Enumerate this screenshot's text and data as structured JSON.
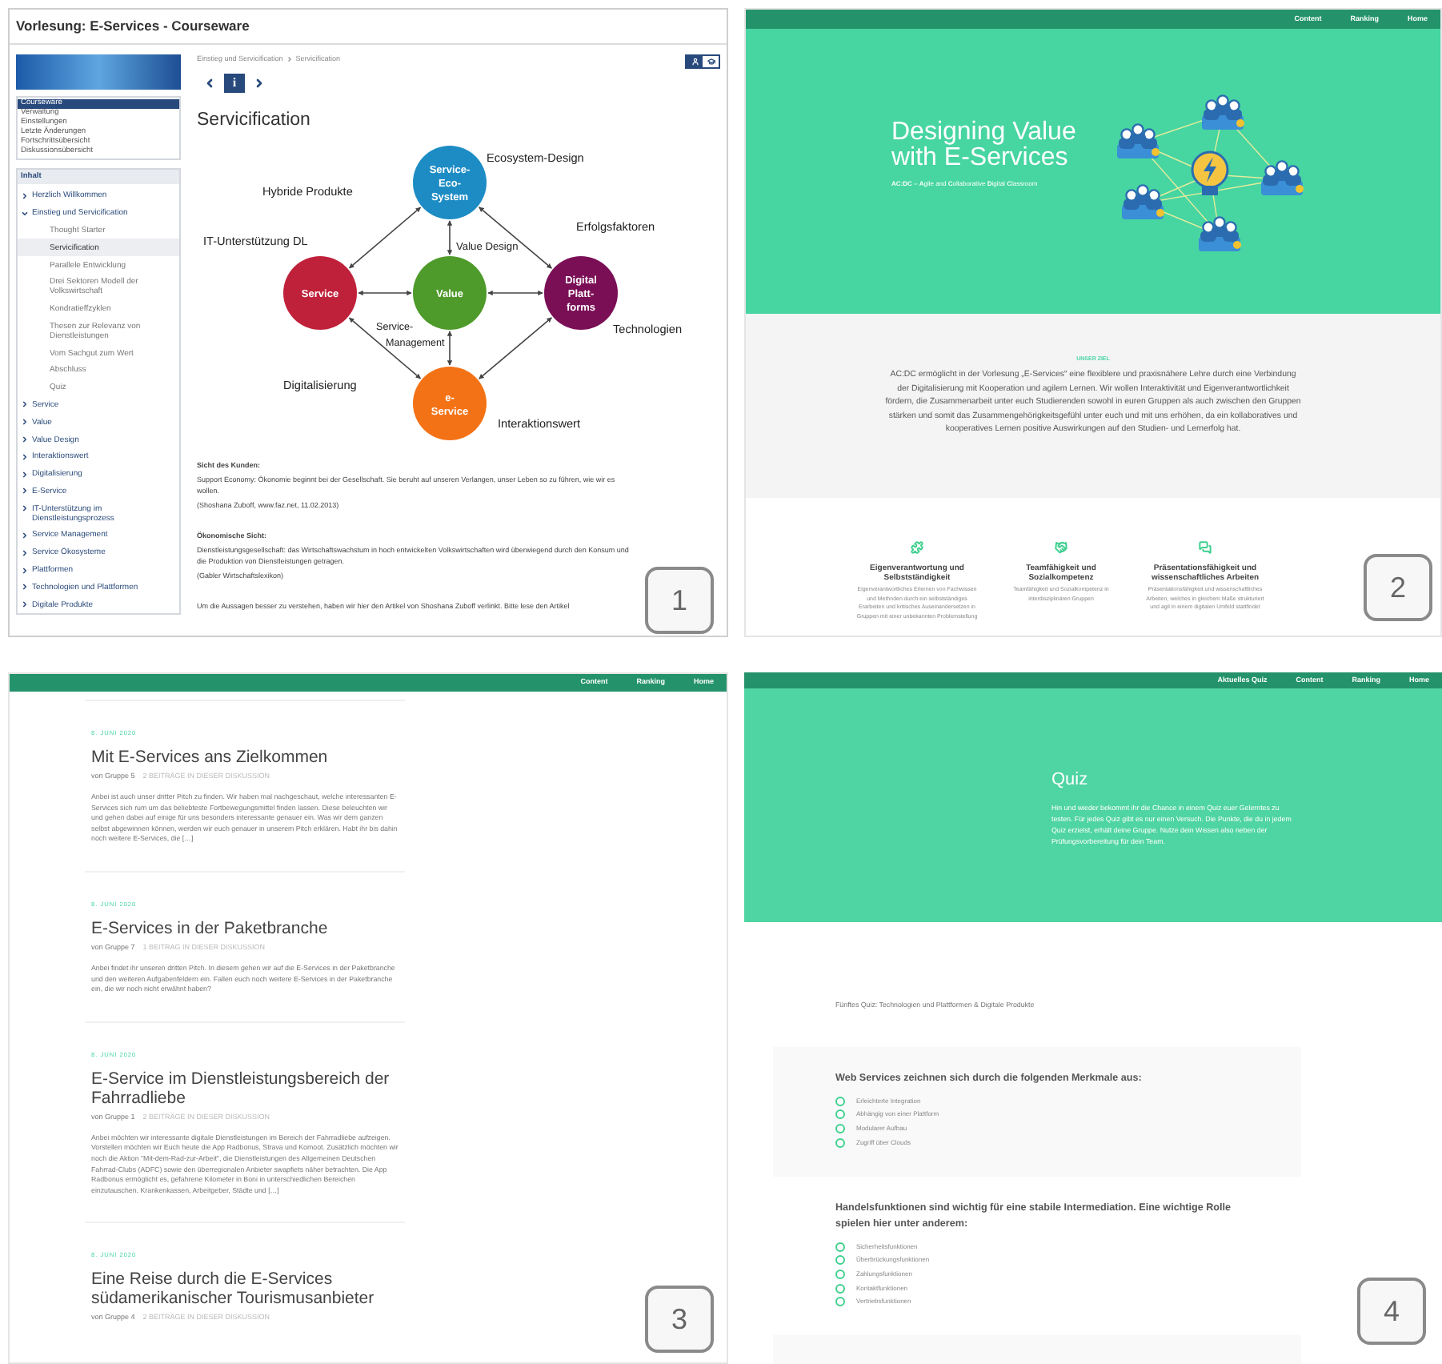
{
  "courseware": {
    "title": "Vorlesung: E-Services - Courseware",
    "menu": [
      {
        "label": "Courseware",
        "selected": true
      },
      {
        "label": "Verwaltung",
        "selected": false
      },
      {
        "label": "Einstellungen",
        "selected": false
      },
      {
        "label": "Letzte Änderungen",
        "selected": false
      },
      {
        "label": "Fortschrittsübersicht",
        "selected": false
      },
      {
        "label": "Diskussionsübersicht",
        "selected": false
      }
    ],
    "contents_header": "Inhalt",
    "tree": [
      {
        "label": "Herzlich Willkommen",
        "expanded": false
      },
      {
        "label": "Einstieg und Servicification",
        "expanded": true,
        "children": [
          {
            "label": "Thought Starter",
            "selected": false
          },
          {
            "label": "Servicification",
            "selected": true
          },
          {
            "label": "Parallele Entwicklung",
            "selected": false
          },
          {
            "label": "Drei Sektoren Modell der Volkswirtschaft",
            "selected": false
          },
          {
            "label": "Kondratieffzyklen",
            "selected": false
          },
          {
            "label": "Thesen zur Relevanz von Dienstleistungen",
            "selected": false
          },
          {
            "label": "Vom Sachgut zum Wert",
            "selected": false
          },
          {
            "label": "Abschluss",
            "selected": false
          },
          {
            "label": "Quiz",
            "selected": false
          }
        ]
      },
      {
        "label": "Service",
        "expanded": false
      },
      {
        "label": "Value",
        "expanded": false
      },
      {
        "label": "Value Design",
        "expanded": false
      },
      {
        "label": "Interaktionswert",
        "expanded": false
      },
      {
        "label": "Digitalisierung",
        "expanded": false
      },
      {
        "label": "E-Service",
        "expanded": false
      },
      {
        "label": "IT-Unterstützung im Dienstleistungsprozess",
        "expanded": false
      },
      {
        "label": "Service Management",
        "expanded": false
      },
      {
        "label": "Service Ökosysteme",
        "expanded": false
      },
      {
        "label": "Plattformen",
        "expanded": false
      },
      {
        "label": "Technologien und Plattformen",
        "expanded": false
      },
      {
        "label": "Digitale Produkte",
        "expanded": false
      }
    ],
    "breadcrumb": [
      "Einstieg und Servicification",
      "Servicification"
    ],
    "view_toggle": [
      {
        "selected": true
      },
      {
        "selected": false
      }
    ],
    "info_button": "i",
    "heading": "Servicification",
    "diagram": {
      "nodes": [
        {
          "lines": [
            "Service-",
            "Eco-",
            "System"
          ],
          "color": "#1d8cc4"
        },
        {
          "lines": [
            "Service"
          ],
          "color": "#c0213a"
        },
        {
          "lines": [
            "Value"
          ],
          "color": "#4e9a2a"
        },
        {
          "lines": [
            "Digital",
            "Platt-",
            "forms"
          ],
          "color": "#7a0f56"
        },
        {
          "lines": [
            "e-",
            "Service"
          ],
          "color": "#f47216"
        }
      ],
      "labels": [
        "Ecosystem-Design",
        "Hybride Produkte",
        "IT-Unterstützung DL",
        "Value Design",
        "Erfolgsfaktoren",
        "Service-",
        "Management",
        "Technologien",
        "Digitalisierung",
        "Interaktionswert"
      ]
    },
    "sections": [
      {
        "heading": "Sicht des Kunden:",
        "paragraphs": [
          "Support Economy: Ökonomie beginnt bei der Gesellschaft. Sie beruht auf unseren Verlangen, unser Leben so zu führen, wie wir es wollen.",
          "(Shoshana Zuboff, www.faz.net, 11.02.2013)"
        ]
      },
      {
        "heading": "Ökonomische Sicht:",
        "paragraphs": [
          "Dienstleistungsgesellschaft: das Wirtschaftswachstum in hoch entwickelten Volkswirtschaften wird überwiegend durch den Konsum und die Produktion von Dienstleistungen getragen.",
          "(Gabler Wirtschaftslexikon)"
        ]
      }
    ],
    "footer_text": "Um die Aussagen besser zu verstehen, haben wir hier den Artikel von Shoshana Zuboff verlinkt. Bitte lese den Artikel",
    "badge": "1"
  },
  "landing": {
    "nav": [
      "Content",
      "Ranking",
      "Home"
    ],
    "title": "Designing Value with E-Services",
    "subtitle": "**AC:DC** – **A**gile and **C**ollaborative **D**igital **C**lassroom",
    "section_label": "UNSER ZIEL",
    "paragraph": "AC:DC ermöglicht in der Vorlesung „E-Services“ eine flexiblere und praxisnähere Lehre durch eine Verbindung der Digitalisierung mit Kooperation und agilem Lernen. Wir wollen Interaktivität und Eigenverantwortlichkeit fördern, die Zusammenarbeit unter euch Studierenden sowohl in euren Gruppen als auch zwischen den Gruppen stärken und somit das Zusammengehörigkeitsgefühl unter euch und mit uns erhöhen, da ein kollaboratives und kooperatives Lernen positive Auswirkungen auf den Studien- und Lernerfolg hat.",
    "features": [
      {
        "title": "Eigenverantwortung und Selbstständigkeit",
        "text": "Eigenverantwortliches Erlernen von Fachwissen und Methoden durch ein selbstständiges Erarbeiten und kritisches Auseinandersetzen in Gruppen mit einer unbekannten Problemstellung"
      },
      {
        "title": "Teamfähigkeit und Sozialkompetenz",
        "text": "Teamfähigkeit und Sozialkompetenz in interdisziplinären Gruppen"
      },
      {
        "title": "Präsentationsfähigkeit und wissenschaftliches Arbeiten",
        "text": "Präsentationsfähigkeit und wissenschaftliches Arbeiten, welches in gleichem Maße strukturiert und agil in einem digitalen Umfeld stattfindet"
      }
    ],
    "badge": "2"
  },
  "blog": {
    "nav": [
      "Content",
      "Ranking",
      "Home"
    ],
    "posts": [
      {
        "date": "8. JUNI 2020",
        "title": "Mit E-Services ans Zielkommen",
        "author": "von Gruppe 5",
        "comments": "2 BEITRÄGE IN DIESER DISKUSSION",
        "excerpt": "Anbei ist auch unser dritter Pitch zu finden. Wir haben mal nachgeschaut, welche interessanten E-Services sich rum um das beliebteste Fortbewegungsmittel finden lassen. Diese beleuchten wir und gehen dabei auf einige für uns besonders interessante genauer ein. Was wir dem ganzen selbst abgewinnen können, werden wir euch genauer in unserem Pitch erklären. Habt ihr bis dahin noch weitere E-Services, die […]"
      },
      {
        "date": "8. JUNI 2020",
        "title": "E-Services in der Paketbranche",
        "author": "von Gruppe 7",
        "comments": "1 BEITRAG IN DIESER DISKUSSION",
        "excerpt": "Anbei findet ihr unseren dritten Pitch. In diesem gehen wir auf die E-Services in der Paketbranche und den weiteren Aufgabenfeldern ein. Fallen euch noch weitere E-Services in der Paketbranche ein, die wir noch nicht erwähnt haben?"
      },
      {
        "date": "8. JUNI 2020",
        "title": "E-Service im Dienstleistungsbereich der Fahrradliebe",
        "author": "von Gruppe 1",
        "comments": "2 BEITRÄGE IN DIESER DISKUSSION",
        "excerpt": "Anbei möchten wir interessante digitale Dienstleistungen im Bereich der Fahrradliebe aufzeigen. Vorstellen möchten wir Euch heute die App Radbonus, Strava und Komoot. Zusätzlich möchten wir noch die Aktion \"Mit-dem-Rad-zur-Arbeit\", die Dienstleistungen des Allgemeinen Deutschen Fahrrad-Clubs (ADFC) sowie den überregionalen Anbieter swapfiets näher betrachten. Die App Radbonus ermöglicht es, gefahrene Kilometer in Boni in unterschiedlichen Bereichen einzutauschen. Krankenkassen, Arbeitgeber, Städte und […]"
      },
      {
        "date": "8. JUNI 2020",
        "title": "Eine Reise durch die E-Services südamerikanischer Tourismusanbieter",
        "author": "von Gruppe 4",
        "comments": "2 BEITRÄGE IN DIESER DISKUSSION"
      }
    ],
    "badge": "3"
  },
  "quiz": {
    "nav": [
      "Aktuelles Quiz",
      "Content",
      "Ranking",
      "Home"
    ],
    "title": "Quiz",
    "intro": "Hin und wieder bekommt ihr die Chance in einem Quiz euer Gelerntes zu testen. Für jedes Quiz gibt es nur einen Versuch. Die Punkte, die du in jedem Quiz erzielst, erhält deine Gruppe. Nutze dein Wissen also neben der Prüfungsvorbereitung für dein Team.",
    "quiz_name": "Fünftes Quiz: Technologien und Plattformen & Digitale Produkte",
    "questions": [
      {
        "text": "Web Services zeichnen sich durch die folgenden Merkmale aus:",
        "options": [
          {
            "label": "Erleichterte Integration",
            "selected": false
          },
          {
            "label": "Abhängig von einer Plattform",
            "selected": false
          },
          {
            "label": "Modularer Aufbau",
            "selected": false
          },
          {
            "label": "Zugriff über Clouds",
            "selected": false
          }
        ]
      },
      {
        "text": "Handelsfunktionen sind wichtig für eine stabile Intermediation. Eine wichtige Rolle spielen hier unter anderem:",
        "options": [
          {
            "label": "Sicherheitsfunktionen",
            "selected": false
          },
          {
            "label": "Überbrückungsfunktionen",
            "selected": false
          },
          {
            "label": "Zahlungsfunktionen",
            "selected": false
          },
          {
            "label": "Kontaktfunktionen",
            "selected": false
          },
          {
            "label": "Vertriebsfunktionen",
            "selected": false
          }
        ]
      }
    ],
    "badge": "4"
  }
}
